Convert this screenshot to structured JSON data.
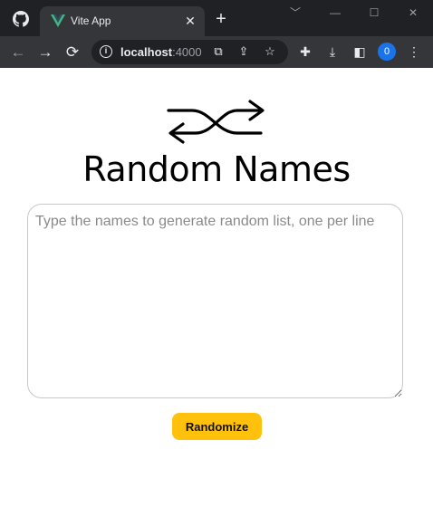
{
  "browser": {
    "tab": {
      "title": "Vite App",
      "favicon": "vue-logo-icon",
      "close_glyph": "✕"
    },
    "new_tab_glyph": "+",
    "window_controls": [
      "﹀",
      "—",
      "☐",
      "✕"
    ],
    "address": {
      "host": "localhost",
      "port": ":4000"
    },
    "profile_initial": "0",
    "colors": {
      "frame": "#202124",
      "toolbar": "#35363a",
      "profile": "#1a73e8",
      "vue_green": "#41b883"
    }
  },
  "app": {
    "logo": "shuffle-icon",
    "title": "Random Names",
    "names_input": {
      "value": "",
      "placeholder": "Type the names to generate random list, one per line"
    },
    "randomize_button": "Randomize",
    "accent_color": "#ffc10b"
  }
}
